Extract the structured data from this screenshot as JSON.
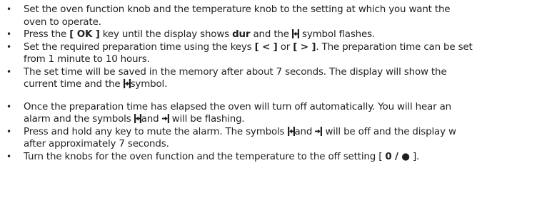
{
  "instructions": {
    "group1": [
      {
        "lines": [
          "Set the oven function knob and the temperature knob to the setting at which you want the",
          "oven to operate."
        ]
      },
      {
        "before": "Press the ",
        "key": "[ OK ]",
        "mid": " key until the display shows ",
        "mode": "dur",
        "after_pre": " and the ",
        "after": " symbol flashes."
      },
      {
        "lines_rich": [
          "Set the required preparation time using the keys ",
          "[ < ]",
          " or ",
          "[ > ]",
          ". The preparation time can be set"
        ],
        "line2": "from 1 minute to 10 hours."
      },
      {
        "line1": "The set time will be saved in the memory after about 7 seconds. The display will show the",
        "line2_pre": "current time and the ",
        "line2_post": "symbol."
      }
    ],
    "group2": [
      {
        "line1": "Once the preparation time has elapsed the oven will turn off automatically. You will hear an",
        "line2_pre": "alarm and the symbols ",
        "line2_mid": "and ",
        "line2_post": " will be flashing."
      },
      {
        "line1_pre": "Press and hold any key to mute the alarm. The symbols ",
        "line1_mid": "and ",
        "line1_post": " will be off and the display w",
        "line2": "after approximately  7 seconds."
      },
      {
        "pre": "Turn the knobs for the oven function and the temperature to the off setting [ ",
        "off": "0 / ●",
        "post": " ]."
      }
    ]
  },
  "icons": {
    "duration": "duration-symbol-icon",
    "end": "end-time-symbol-icon"
  },
  "bullet_glyph": "•"
}
